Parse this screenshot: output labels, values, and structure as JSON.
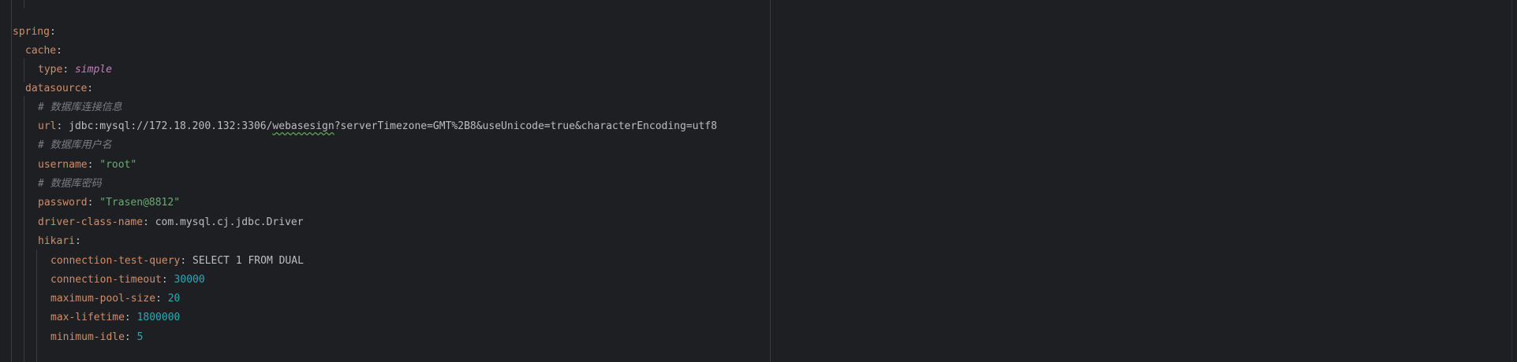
{
  "colors": {
    "background": "#1e1f22",
    "key": "#cf8e6d",
    "text": "#bcbec4",
    "comment": "#7a7e85",
    "string": "#6aab73",
    "number": "#2aacb8",
    "enum_value": "#c77dbb"
  },
  "yaml": {
    "spring_key": "spring",
    "cache_key": "cache",
    "cache_type_key": "type",
    "cache_type_value": "simple",
    "datasource_key": "datasource",
    "comment_url": "# 数据库连接信息",
    "url_key": "url",
    "url_prefix": "jdbc:mysql://172.18.200.132:3306/",
    "url_db": "webasesign",
    "url_suffix": "?serverTimezone=GMT%2B8&useUnicode=true&characterEncoding=utf8",
    "comment_username": "# 数据库用户名",
    "username_key": "username",
    "username_value": "\"root\"",
    "comment_password": "# 数据库密码",
    "password_key": "password",
    "password_value": "\"Trasen@8812\"",
    "driver_key": "driver-class-name",
    "driver_value": "com.mysql.cj.jdbc.Driver",
    "hikari_key": "hikari",
    "test_query_key": "connection-test-query",
    "test_query_value": "SELECT 1 FROM DUAL",
    "timeout_key": "connection-timeout",
    "timeout_value": "30000",
    "pool_key": "maximum-pool-size",
    "pool_value": "20",
    "lifetime_key": "max-lifetime",
    "lifetime_value": "1800000",
    "idle_key": "minimum-idle",
    "idle_value": "5",
    "colon": ":",
    "colon_space": ": "
  }
}
